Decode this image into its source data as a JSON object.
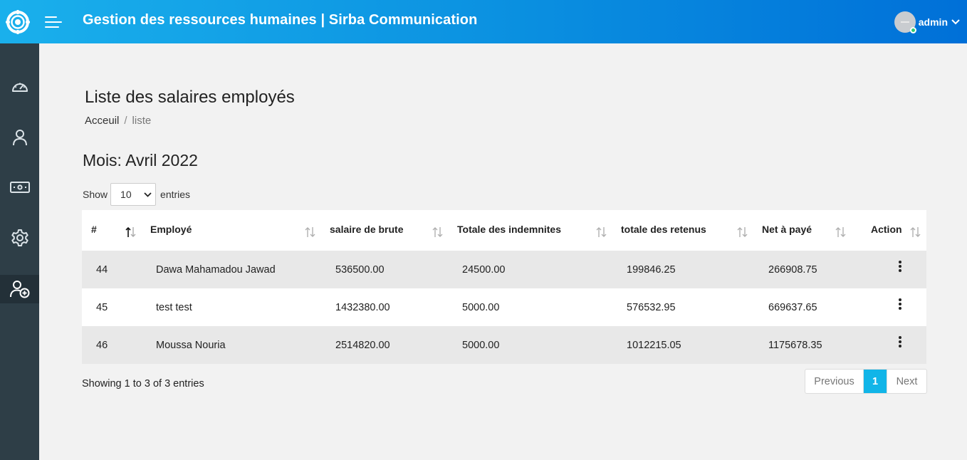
{
  "app": {
    "title": "Gestion des ressources humaines | Sirba Communication",
    "user": "admin"
  },
  "sidebar": {
    "items": [
      {
        "icon": "dashboard-icon"
      },
      {
        "icon": "user-icon"
      },
      {
        "icon": "money-icon"
      },
      {
        "icon": "gear-icon"
      },
      {
        "icon": "user-add-icon",
        "active": true
      }
    ]
  },
  "page": {
    "title": "Liste des salaires employés",
    "breadcrumb": {
      "home": "Acceuil",
      "separator": "/",
      "current": "liste"
    },
    "month": "Mois: Avril 2022"
  },
  "length": {
    "show": "Show",
    "value": "10",
    "entries": "entries"
  },
  "table": {
    "columns": [
      "#",
      "Employé",
      "salaire de brute",
      "Totale des indemnites",
      "totale des retenus",
      "Net à payé",
      "Action"
    ],
    "rows": [
      {
        "id": "44",
        "name": "Dawa Mahamadou Jawad",
        "brut": "536500.00",
        "indemnites": "24500.00",
        "retenus": "199846.25",
        "net": "266908.75"
      },
      {
        "id": "45",
        "name": "test test",
        "brut": "1432380.00",
        "indemnites": "5000.00",
        "retenus": "576532.95",
        "net": "669637.65"
      },
      {
        "id": "46",
        "name": "Moussa Nouria",
        "brut": "2514820.00",
        "indemnites": "5000.00",
        "retenus": "1012215.05",
        "net": "1175678.35"
      }
    ]
  },
  "info": "Showing 1 to 3 of 3 entries",
  "pagination": {
    "previous": "Previous",
    "current": "1",
    "next": "Next"
  },
  "colors": {
    "accent": "#11b5e8",
    "sidebar": "#2e3e47",
    "header_start": "#1ab0ec",
    "header_end": "#0070d8"
  }
}
